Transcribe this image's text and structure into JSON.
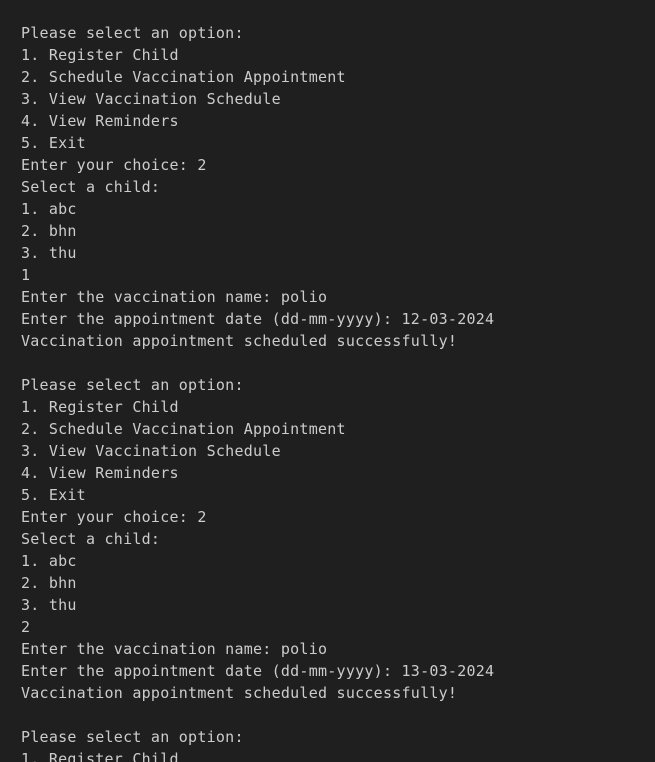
{
  "terminal": {
    "lines": [
      "Please select an option:",
      "1. Register Child",
      "2. Schedule Vaccination Appointment",
      "3. View Vaccination Schedule",
      "4. View Reminders",
      "5. Exit",
      "Enter your choice: 2",
      "Select a child:",
      "1. abc",
      "2. bhn",
      "3. thu",
      "1",
      "Enter the vaccination name: polio",
      "Enter the appointment date (dd-mm-yyyy): 12-03-2024",
      "Vaccination appointment scheduled successfully!",
      "",
      "Please select an option:",
      "1. Register Child",
      "2. Schedule Vaccination Appointment",
      "3. View Vaccination Schedule",
      "4. View Reminders",
      "5. Exit",
      "Enter your choice: 2",
      "Select a child:",
      "1. abc",
      "2. bhn",
      "3. thu",
      "2",
      "Enter the vaccination name: polio",
      "Enter the appointment date (dd-mm-yyyy): 13-03-2024",
      "Vaccination appointment scheduled successfully!",
      "",
      "Please select an option:",
      "1. Register Child"
    ]
  }
}
